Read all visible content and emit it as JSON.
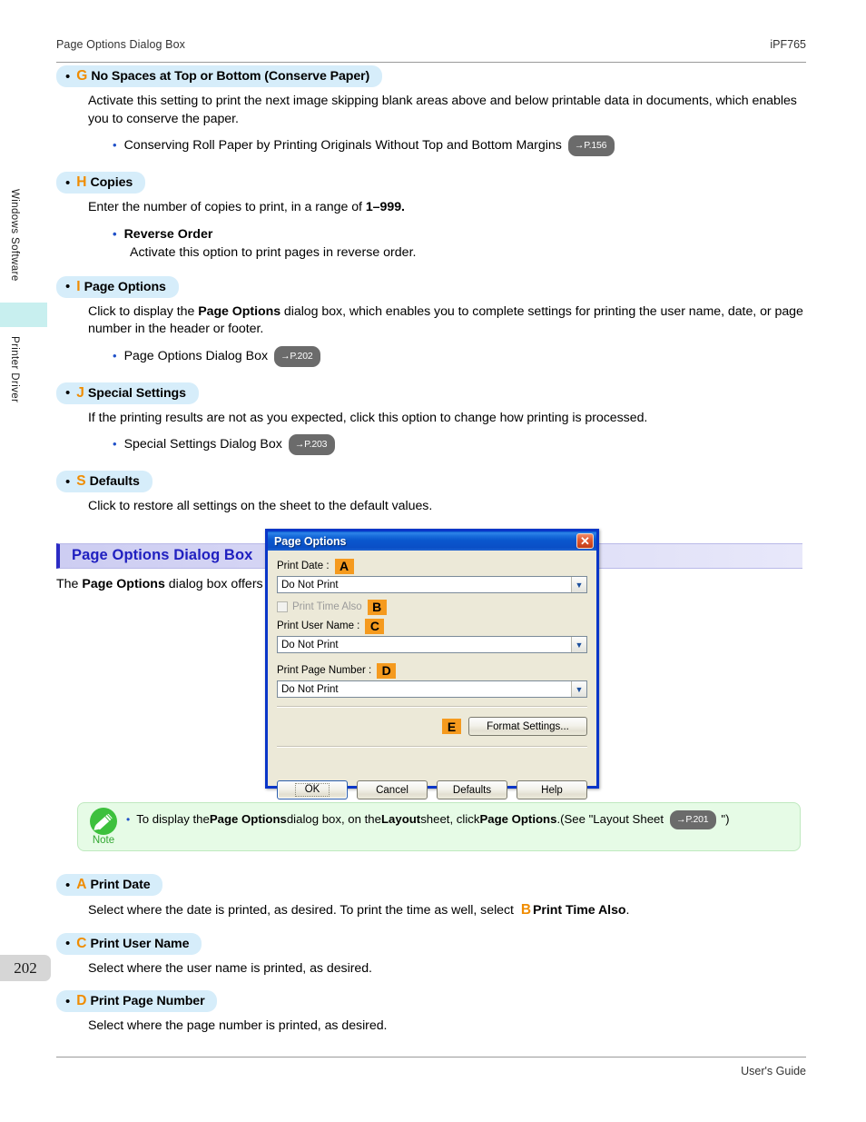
{
  "header": {
    "left_title": "Page Options Dialog Box",
    "right_title": "iPF765"
  },
  "sidebar": {
    "tabs": [
      {
        "label": "Windows Software"
      },
      {
        "label": "Printer Driver"
      }
    ],
    "page_number": "202"
  },
  "sections": [
    {
      "letter": "G",
      "title": "No Spaces at Top or Bottom (Conserve Paper)",
      "body": "Activate this setting to print the next image skipping blank areas above and below printable data in documents, which enables you to conserve the paper.",
      "sub_link_text": "Conserving Roll Paper by Printing Originals Without Top and Bottom Margins",
      "sub_link_ref": "→P.156"
    },
    {
      "letter": "H",
      "title": "Copies",
      "body_pre": "Enter the number of copies to print, in a range of ",
      "body_bold": "1–999.",
      "sub_heading": "Reverse Order",
      "sub_body": "Activate this option to print pages in reverse order."
    },
    {
      "letter": "I",
      "title": "Page Options",
      "body_pre": "Click to display the ",
      "body_bold": "Page Options",
      "body_post": " dialog box, which enables you to complete settings for printing the user name, date, or page number in the header or footer.",
      "sub_link_text": "Page Options Dialog Box",
      "sub_link_ref": "→P.202"
    },
    {
      "letter": "J",
      "title": "Special Settings",
      "body": "If the printing results are not as you expected, click this option to change how printing is processed.",
      "sub_link_text": "Special Settings Dialog Box",
      "sub_link_ref": "→P.203"
    },
    {
      "letter": "S",
      "title": "Defaults",
      "body": "Click to restore all settings on the sheet to the default values."
    }
  ],
  "main_section": {
    "heading": "Page Options Dialog Box",
    "intro_pre": "The ",
    "intro_bold": "Page Options",
    "intro_post": " dialog box offers the following settings."
  },
  "dialog": {
    "title": "Page Options",
    "close_glyph": "✕",
    "fields": {
      "print_date": {
        "label": "Print Date :",
        "tag": "A",
        "value": "Do Not Print"
      },
      "print_time_also": {
        "label": "Print Time Also",
        "tag": "B",
        "checked": false,
        "disabled": true
      },
      "print_user_name": {
        "label": "Print User Name :",
        "tag": "C",
        "value": "Do Not Print"
      },
      "print_page_number": {
        "label": "Print Page Number :",
        "tag": "D",
        "value": "Do Not Print"
      }
    },
    "format_settings": {
      "tag": "E",
      "label": "Format Settings..."
    },
    "buttons": {
      "ok": "OK",
      "cancel": "Cancel",
      "defaults": "Defaults",
      "help": "Help"
    }
  },
  "note": {
    "label": "Note",
    "text_1": "To display the ",
    "bold_1": "Page Options",
    "text_2": " dialog box, on the ",
    "bold_2": "Layout",
    "text_3": " sheet, click ",
    "bold_3": "Page Options",
    "text_4": ".(See \"Layout Sheet",
    "ref": "→P.201",
    "text_5": "\")"
  },
  "lower_sections": [
    {
      "letter": "A",
      "title": "Print Date",
      "body_pre": "Select where the date is printed, as desired. To print the time as well, select ",
      "inline_letter": "B",
      "body_bold": "Print Time Also",
      "body_post": "."
    },
    {
      "letter": "C",
      "title": "Print User Name",
      "body": "Select where the user name is printed, as desired."
    },
    {
      "letter": "D",
      "title": "Print Page Number",
      "body": "Select where the page number is printed, as desired."
    }
  ],
  "footer": {
    "text": "User's Guide"
  }
}
